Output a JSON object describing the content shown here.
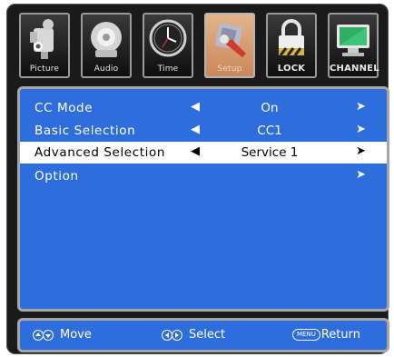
{
  "tabs": [
    {
      "label": "Picture",
      "icon": "camera-icon"
    },
    {
      "label": "Audio",
      "icon": "speaker-icon"
    },
    {
      "label": "Time",
      "icon": "clock-icon"
    },
    {
      "label": "Setup",
      "icon": "wrench-icon",
      "active": true
    },
    {
      "label": "LOCK",
      "icon": "lock-icon"
    },
    {
      "label": "CHANNEL",
      "icon": "monitor-icon"
    }
  ],
  "menu": {
    "rows": [
      {
        "label": "CC Mode",
        "value": "On",
        "left_arrow": "◀",
        "right_arrow": "➤"
      },
      {
        "label": "Basic Selection",
        "value": "CC1",
        "left_arrow": "◀",
        "right_arrow": "➤"
      },
      {
        "label": "Advanced Selection",
        "value": "Service 1",
        "left_arrow": "◀",
        "right_arrow": "➤",
        "selected": true
      },
      {
        "label": "Option",
        "value": "",
        "left_arrow": "",
        "right_arrow": "➤"
      }
    ]
  },
  "footer": {
    "move": "Move",
    "select": "Select",
    "menu_key": "MENU",
    "return": "Return"
  },
  "colors": {
    "panel": "#2e6edc",
    "active_tab": "#d9a070",
    "selected_row": "#ffffff"
  }
}
